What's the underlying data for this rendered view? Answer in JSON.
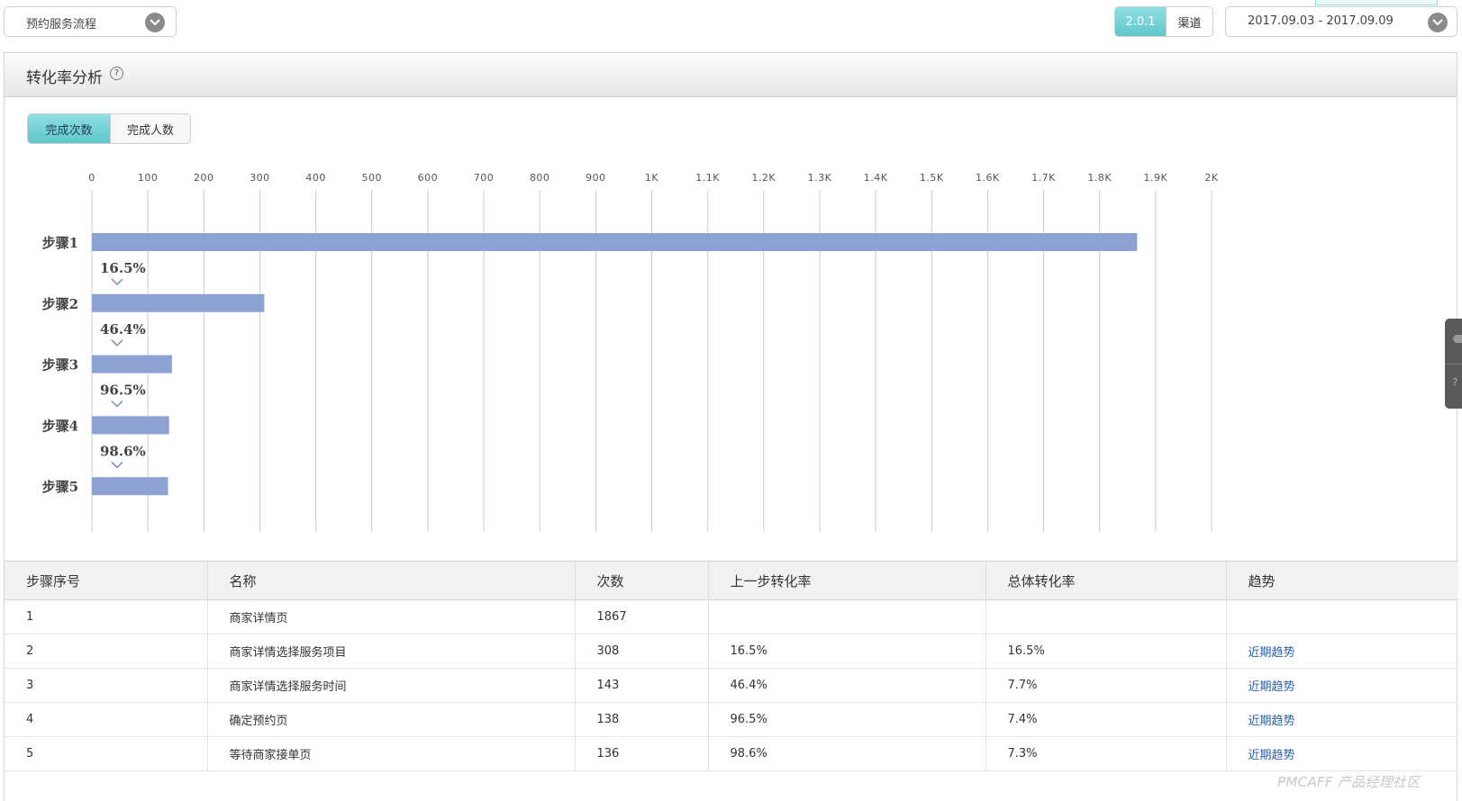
{
  "toolbar": {
    "flow_select": "预约服务流程",
    "version_options": [
      "2.0.1",
      "渠道"
    ],
    "date_range": "2017.09.03 - 2017.09.09"
  },
  "panel": {
    "title": "转化率分析",
    "help_icon": "?",
    "mode_tabs": [
      "完成次数",
      "完成人数"
    ]
  },
  "chart_data": {
    "type": "bar",
    "orientation": "horizontal",
    "categories": [
      "步骤1",
      "步骤2",
      "步骤3",
      "步骤4",
      "步骤5"
    ],
    "values": [
      1867,
      308,
      143,
      138,
      136
    ],
    "conversion_labels": [
      "16.5%",
      "46.4%",
      "96.5%",
      "98.6%"
    ],
    "x_ticks": [
      "0",
      "100",
      "200",
      "300",
      "400",
      "500",
      "600",
      "700",
      "800",
      "900",
      "1K",
      "1.1K",
      "1.2K",
      "1.3K",
      "1.4K",
      "1.5K",
      "1.6K",
      "1.7K",
      "1.8K",
      "1.9K",
      "2K"
    ],
    "xlim": [
      0,
      2000
    ],
    "axis_position": "top",
    "grid": true,
    "bar_color": "#8ba2d3"
  },
  "table": {
    "headers": [
      "步骤序号",
      "名称",
      "次数",
      "上一步转化率",
      "总体转化率",
      "趋势"
    ],
    "rows": [
      [
        "1",
        "商家详情页",
        "1867",
        "",
        "",
        ""
      ],
      [
        "2",
        "商家详情选择服务项目",
        "308",
        "16.5%",
        "16.5%",
        "近期趋势"
      ],
      [
        "3",
        "商家详情选择服务时间",
        "143",
        "46.4%",
        "7.7%",
        "近期趋势"
      ],
      [
        "4",
        "确定预约页",
        "138",
        "96.5%",
        "7.4%",
        "近期趋势"
      ],
      [
        "5",
        "等待商家接单页",
        "136",
        "98.6%",
        "7.3%",
        "近期趋势"
      ]
    ]
  },
  "side_widget": {
    "help": "?"
  },
  "watermark": "PMCAFF 产品经理社区"
}
